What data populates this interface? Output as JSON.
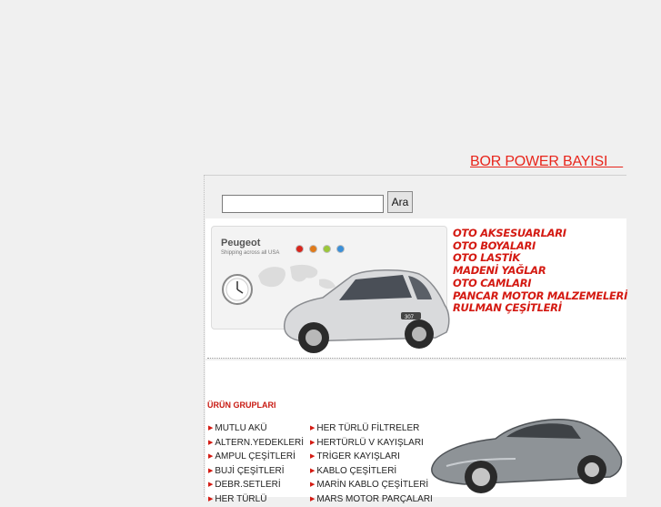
{
  "header": {
    "brand_link": "BOR POWER BAYISI    "
  },
  "search": {
    "value": "",
    "button_label": "Ara"
  },
  "banner": {
    "card_title": "Peugeot",
    "card_subtitle": "Shipping across all USA",
    "car_badge": "307",
    "dot_colors": [
      "#d8261d",
      "#e07a1a",
      "#9bc73a",
      "#3a8fd8"
    ],
    "items": [
      "OTO AKSESUARLARI",
      "OTO BOYALARI",
      "OTO LASTİK",
      "MADENİ YAĞLAR",
      "OTO CAMLARI",
      "PANCAR MOTOR MALZEMELERİ",
      "RULMAN ÇEŞİTLERİ"
    ]
  },
  "products": {
    "title": "ÜRÜN GRUPLARI",
    "col1": [
      "MUTLU AKÜ",
      "ALTERN.YEDEKLERİ",
      "AMPUL ÇEŞİTLERİ",
      "BUJİ ÇEŞİTLERİ",
      "DEBR.SETLERİ",
      "HER TÜRLÜ"
    ],
    "col2": [
      "HER TÜRLÜ FİLTRELER",
      "HERTÜRLÜ V KAYIŞLARI",
      "TRİGER KAYIŞLARI",
      "KABLO ÇEŞİTLERİ",
      "MARİN KABLO ÇEŞİTLERİ",
      "MARS MOTOR PARÇALARI"
    ]
  },
  "colors": {
    "accent": "#e8251b",
    "banner_text": "#d41a12",
    "background": "#f0f0f0"
  },
  "icons": {
    "clock": "clock-icon",
    "arrow": "arrow-right-icon",
    "peugeot_car": "car-image",
    "sports_car": "car-image"
  }
}
